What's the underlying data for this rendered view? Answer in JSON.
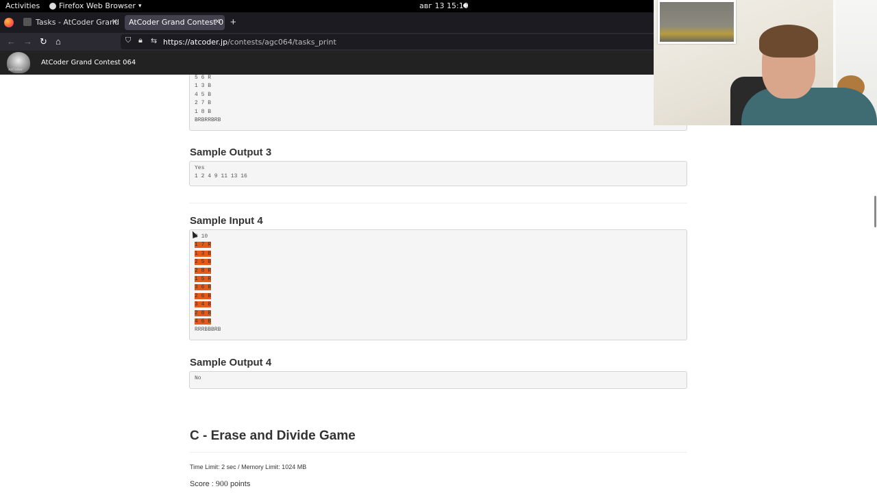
{
  "system_bar": {
    "activities": "Activities",
    "app_name": "Firefox Web Browser",
    "clock": "авг 13  15:10"
  },
  "browser": {
    "tabs": [
      {
        "title": "Tasks - AtCoder Grand Co",
        "active": false
      },
      {
        "title": "AtCoder Grand Contest 0",
        "active": true
      }
    ],
    "url_domain": "https://atcoder.jp",
    "url_path": "/contests/agc064/tasks_print"
  },
  "site": {
    "contest_title": "AtCoder Grand Contest 064",
    "logo_caption": "AtCoder"
  },
  "content": {
    "prev_input_tail": "5 6 R\n1 3 B\n4 5 B\n2 7 B\n1 8 B\nBRBRRBRB",
    "sample_output_3": {
      "title": "Sample Output 3",
      "text": "Yes\n1 2 4 9 11 13 16"
    },
    "sample_input_4": {
      "title": "Sample Input 4",
      "first_line": "8 10",
      "highlighted_lines": [
        "1 7 R",
        "1 3 B",
        "2 5 B",
        "2 8 R",
        "1 5 R",
        "3 6 B",
        "2 6 B",
        "3 4 B",
        "2 8 B",
        "4 6 B"
      ],
      "last_line": "RRRBBBRB"
    },
    "sample_output_4": {
      "title": "Sample Output 4",
      "text": "No"
    },
    "next_problem": {
      "title": "C - Erase and Divide Game",
      "limits": "Time Limit: 2 sec / Memory Limit: 1024 MB",
      "score_label": "Score :",
      "score_value": "900",
      "score_unit": "points"
    }
  },
  "colors": {
    "highlight": "#e35a1b",
    "header_bg": "#222222",
    "firefox_chrome": "#2b2a33"
  }
}
